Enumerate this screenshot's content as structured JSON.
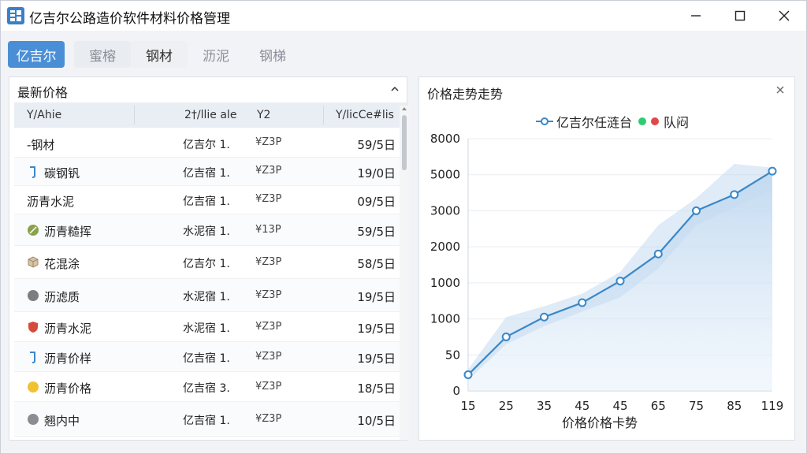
{
  "window": {
    "title": "亿吉尔公路造价软件材料价格管理"
  },
  "tabs": [
    {
      "label": "亿吉尔"
    },
    {
      "label": "蜜榕"
    },
    {
      "label": "钢材"
    },
    {
      "label": "沥泥"
    },
    {
      "label": "钢梯"
    }
  ],
  "left_panel": {
    "title": "最新价格",
    "columns": [
      "Y/Ahie",
      "2†/llie ale",
      "Y2",
      "Y/licCe#lis"
    ],
    "rows": [
      {
        "name": "-钢材",
        "supplier": "亿吉尔 1.",
        "unit": "¥Z3P",
        "date": "59/5日",
        "icon": "none"
      },
      {
        "name": "碳钢钒",
        "supplier": "亿吉宿 1.",
        "unit": "¥Z3P",
        "date": "19/0日",
        "icon": "bracket-icon"
      },
      {
        "name": "沥青水泥",
        "supplier": "亿吉宿 1.",
        "unit": "¥Z3P",
        "date": "09/5日",
        "icon": "none"
      },
      {
        "name": "沥青糙挥",
        "supplier": "水泥宿 1.",
        "unit": "¥13P",
        "date": "59/5日",
        "icon": "leaf-icon"
      },
      {
        "name": "花混涂",
        "supplier": "亿吉尔 1.",
        "unit": "¥Z3P",
        "date": "58/5日",
        "icon": "box-icon"
      },
      {
        "name": "沥滤质",
        "supplier": "水泥宿 1.",
        "unit": "¥Z3P",
        "date": "19/5日",
        "icon": "gray-circle-icon"
      },
      {
        "name": "沥青水泥",
        "supplier": "水泥宿 1.",
        "unit": "¥Z3P",
        "date": "19/5日",
        "icon": "shield-icon"
      },
      {
        "name": "沥青价样",
        "supplier": "亿吉宿 1.",
        "unit": "¥Z3P",
        "date": "19/5日",
        "icon": "bracket-icon"
      },
      {
        "name": "沥青价格",
        "supplier": "亿吉宿 3.",
        "unit": "¥Z3P",
        "date": "18/5日",
        "icon": "yellow-circle-icon"
      },
      {
        "name": "翘内中",
        "supplier": "亿吉宿 1.",
        "unit": "¥Z3P",
        "date": "10/5日",
        "icon": "gray-circle-icon"
      }
    ]
  },
  "right_panel": {
    "title": "价格走势走势",
    "legend": {
      "series_label": "亿吉尔任涟台",
      "extra_label": "队闷",
      "green": "#2ecc71",
      "red": "#e04848"
    }
  },
  "colors": {
    "accent": "#4a8fd6",
    "line": "#3a88c8",
    "area": "#cfe2f4"
  },
  "chart_data": {
    "type": "line",
    "x": [
      "15",
      "25",
      "35",
      "45",
      "45",
      "65",
      "75",
      "85",
      "119"
    ],
    "y_tick_labels": [
      "0",
      "50",
      "1000",
      "1000",
      "2000",
      "3000",
      "5000",
      "8000"
    ],
    "xlabel": "价格价格卡势",
    "ylabel": "",
    "series": [
      {
        "name": "亿吉尔任涟台",
        "values": [
          0.45,
          1.5,
          2.05,
          2.45,
          3.05,
          3.8,
          5.0,
          5.45,
          6.1
        ]
      }
    ],
    "band": {
      "upper": [
        0.6,
        2.05,
        2.35,
        2.7,
        3.3,
        4.6,
        5.35,
        6.3,
        6.2
      ],
      "lower": [
        0.3,
        1.3,
        1.8,
        2.2,
        2.6,
        3.4,
        4.6,
        5.1,
        5.6
      ]
    },
    "ylim": [
      0,
      7
    ],
    "grid": true
  }
}
